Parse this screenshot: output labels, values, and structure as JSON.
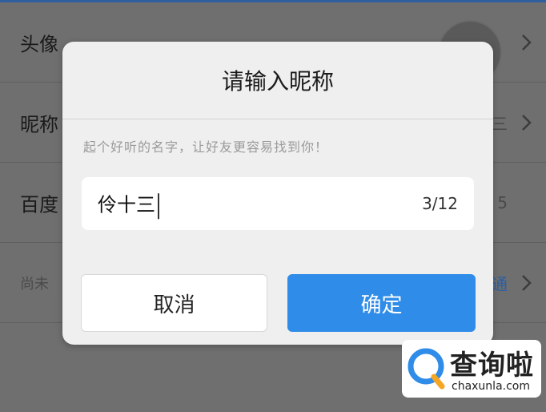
{
  "background": {
    "rows": [
      {
        "label": "头像",
        "value": ""
      },
      {
        "label": "昵称",
        "value": "三"
      },
      {
        "label": "百度",
        "value": "5"
      },
      {
        "label": "尚未",
        "value": "通"
      }
    ]
  },
  "dialog": {
    "title": "请输入昵称",
    "hint": "起个好听的名字，让好友更容易找到你！",
    "input": {
      "value": "伶十三",
      "counter": "3/12"
    },
    "cancel_label": "取消",
    "confirm_label": "确定"
  },
  "watermark": {
    "cn": "查询啦",
    "en": "chaxunla.com"
  },
  "colors": {
    "accent": "#2f8ce8",
    "overlay": "#6f6f6f"
  }
}
